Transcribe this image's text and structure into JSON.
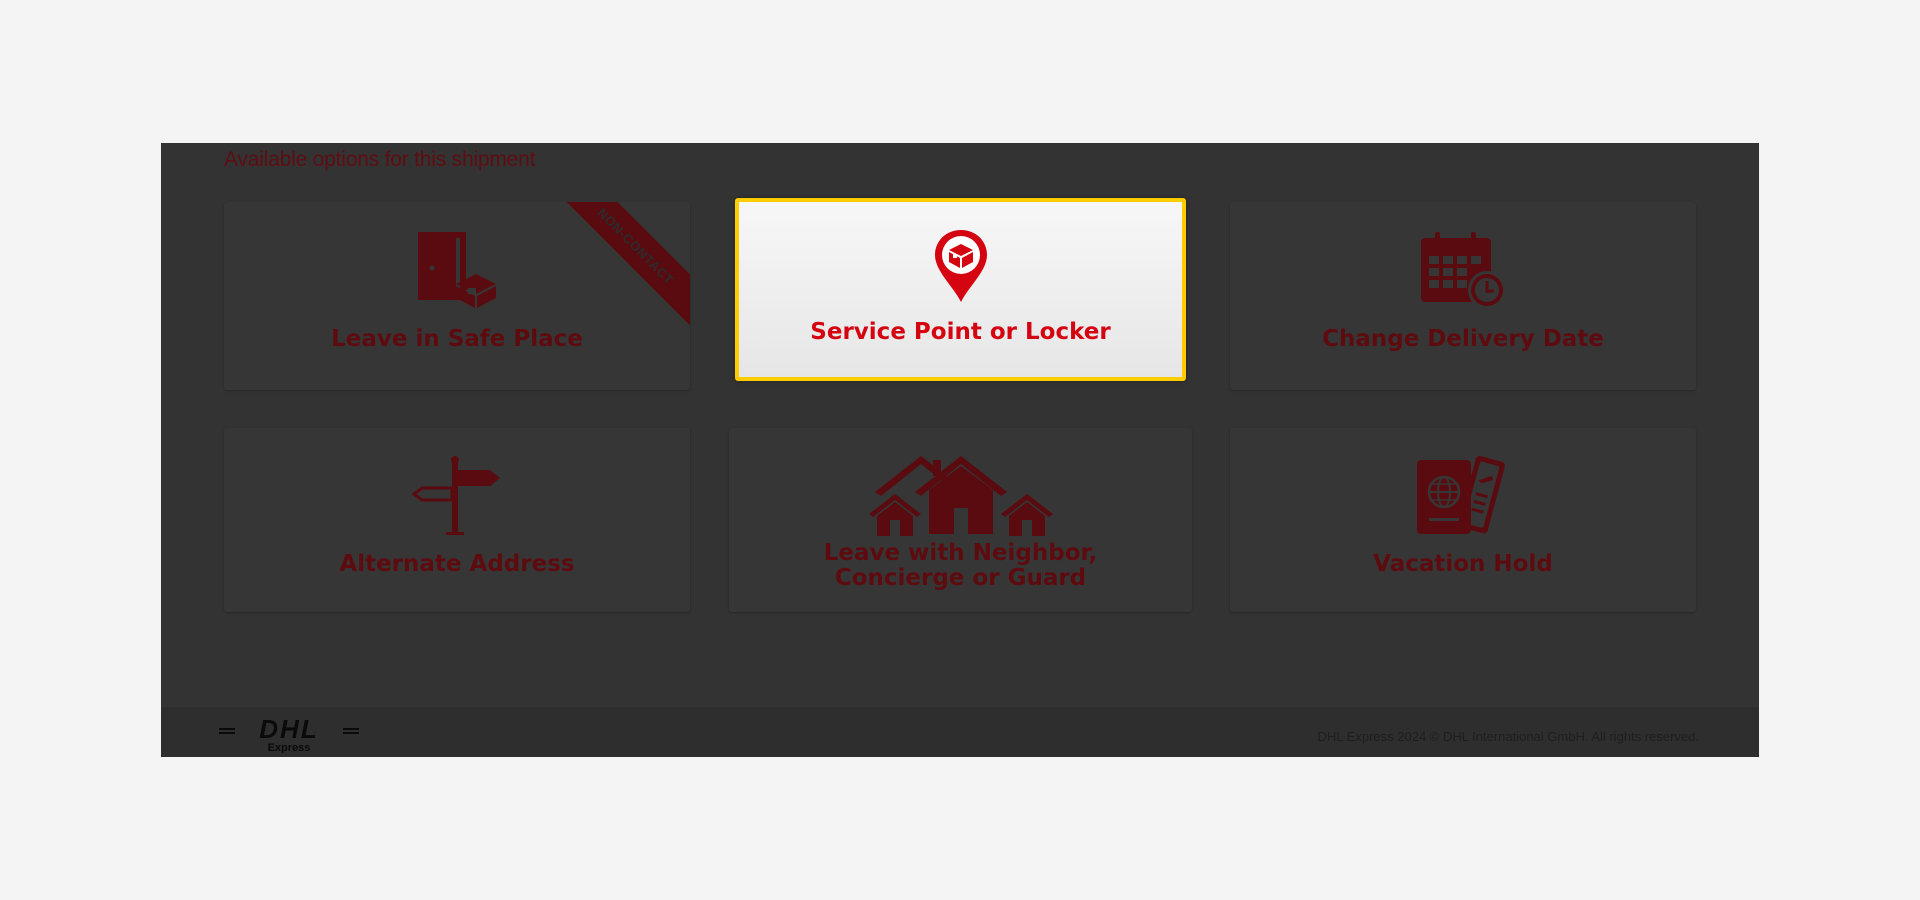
{
  "section": {
    "heading": "Available options for this shipment"
  },
  "options": [
    {
      "label": "Leave in Safe Place",
      "icon": "door-package-icon",
      "ribbon": "NON-CONTACT"
    },
    {
      "label": "Service Point or Locker",
      "icon": "location-pin-package-icon",
      "selected": true
    },
    {
      "label": "Change Delivery Date",
      "icon": "calendar-clock-icon"
    },
    {
      "label": "Alternate Address",
      "icon": "signpost-icon"
    },
    {
      "label_line1": "Leave with Neighbor,",
      "label_line2": "Concierge or Guard",
      "icon": "houses-icon"
    },
    {
      "label": "Vacation Hold",
      "icon": "passport-ticket-icon"
    }
  ],
  "footer": {
    "logo": {
      "brand": "DHL",
      "sub": "Express"
    },
    "copyright": "DHL Express 2024 © DHL International GmbH. All rights reserved."
  },
  "colors": {
    "brand_red": "#d40511",
    "dimmed_red": "#5e0b10",
    "highlight_border": "#ffcc00",
    "overlay": "#333333"
  }
}
